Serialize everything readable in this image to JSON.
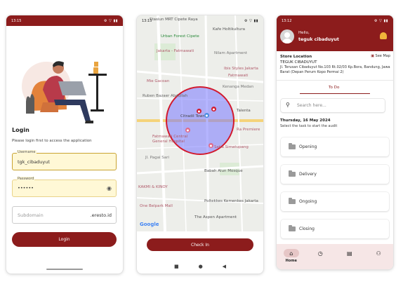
{
  "phones": {
    "login": {
      "status": {
        "time": "13:15",
        "left_icons": "✉ ● ◎ ◎ ·",
        "right_icons": "⚙ ▽ ▮▮"
      },
      "title": "Login",
      "subtitle": "Please login first to access the application",
      "username": {
        "label": "Username",
        "value": "tgk_cibaduyut"
      },
      "password": {
        "label": "Password",
        "value": "••••••"
      },
      "subdomain": {
        "placeholder": "Subdomain",
        "suffix": ".eresto.id"
      },
      "login_button": "Login"
    },
    "checkin": {
      "status": {
        "time": "13:15",
        "left_icons": "✉ ● ◎ ◎ ·",
        "right_icons": "⚙ ▽ ▮▮"
      },
      "map_labels": [
        "Stasiun MRT Cipete Raya",
        "Urban Forest Cipete",
        "Jakarta - Fatmawati",
        "Kafe Holtikultura",
        "Ibis Styles Jakarta",
        "Fatmawati",
        "Nilam Apartment",
        "Kenanga Medan",
        "Jl. Leeleng",
        "Mie Gacoan",
        "Jakarta - Fatmawati",
        "Ruben Bazaer Abdullah",
        "Citradil Town",
        "Talenta",
        "Ra Premiere",
        "Kemang",
        "Fatmawati Central",
        "General Hospital",
        "Setia Simatupang",
        "Jl. Pagai Sari",
        "Jl. Kebagusan",
        "Babah Alun Mosque",
        "KAKMI & KINOY",
        "Fatmawati",
        "One Belpark Mall",
        "Lebak Bulus",
        "Poltekkes Kemenkes Jakarta",
        "The Aspen Apartment",
        "Google"
      ],
      "checkin_button": "Check In",
      "nav_icons": [
        "■",
        "●",
        "◀"
      ]
    },
    "audit": {
      "status": {
        "time": "13:12",
        "left_icons": "✉ ● ◎ ◎ ·",
        "right_icons": "⚙ ▽ ▮▮"
      },
      "greeting": "Hello,",
      "username": "teguk cibaduyut",
      "store_location_label": "Store Location",
      "see_map": "See Map",
      "store_name": "TEGUK CIBADUYUT",
      "store_address": "Jl. Terusan Cibaduyut No.103 Rt.02/03 Kp.Bora, Bandung, Jawa Barat (Depan Perum Kopo Permai 2)",
      "tab": "To Do",
      "search_placeholder": "Search here...",
      "date": "Thursday, 16 May 2024",
      "instruction": "Select the task to start the audit",
      "tasks": [
        "Opening",
        "Delivery",
        "Ongoing",
        "Closing"
      ],
      "nav": [
        {
          "icon": "home-icon",
          "glyph": "⌂",
          "label": "Home"
        },
        {
          "icon": "history-icon",
          "glyph": "◷",
          "label": ""
        },
        {
          "icon": "clipboard-icon",
          "glyph": "▤",
          "label": ""
        },
        {
          "icon": "profile-icon",
          "glyph": "⚇",
          "label": ""
        }
      ]
    }
  }
}
